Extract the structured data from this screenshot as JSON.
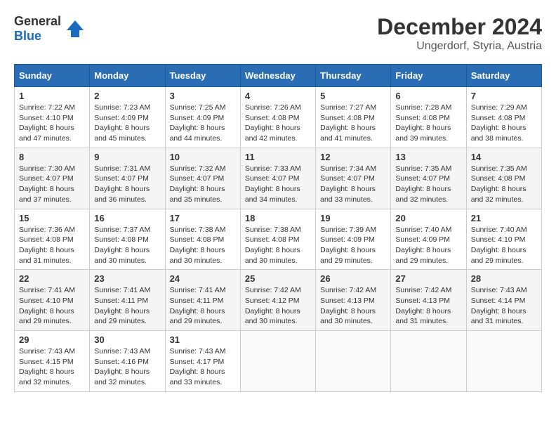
{
  "header": {
    "logo_line1": "General",
    "logo_line2": "Blue",
    "month_year": "December 2024",
    "location": "Ungerdorf, Styria, Austria"
  },
  "calendar": {
    "headers": [
      "Sunday",
      "Monday",
      "Tuesday",
      "Wednesday",
      "Thursday",
      "Friday",
      "Saturday"
    ],
    "weeks": [
      [
        null,
        null,
        null,
        null,
        null,
        null,
        null
      ]
    ],
    "days": {
      "1": {
        "sunrise": "7:22 AM",
        "sunset": "4:10 PM",
        "daylight": "8 hours and 47 minutes."
      },
      "2": {
        "sunrise": "7:23 AM",
        "sunset": "4:09 PM",
        "daylight": "8 hours and 45 minutes."
      },
      "3": {
        "sunrise": "7:25 AM",
        "sunset": "4:09 PM",
        "daylight": "8 hours and 44 minutes."
      },
      "4": {
        "sunrise": "7:26 AM",
        "sunset": "4:08 PM",
        "daylight": "8 hours and 42 minutes."
      },
      "5": {
        "sunrise": "7:27 AM",
        "sunset": "4:08 PM",
        "daylight": "8 hours and 41 minutes."
      },
      "6": {
        "sunrise": "7:28 AM",
        "sunset": "4:08 PM",
        "daylight": "8 hours and 39 minutes."
      },
      "7": {
        "sunrise": "7:29 AM",
        "sunset": "4:08 PM",
        "daylight": "8 hours and 38 minutes."
      },
      "8": {
        "sunrise": "7:30 AM",
        "sunset": "4:07 PM",
        "daylight": "8 hours and 37 minutes."
      },
      "9": {
        "sunrise": "7:31 AM",
        "sunset": "4:07 PM",
        "daylight": "8 hours and 36 minutes."
      },
      "10": {
        "sunrise": "7:32 AM",
        "sunset": "4:07 PM",
        "daylight": "8 hours and 35 minutes."
      },
      "11": {
        "sunrise": "7:33 AM",
        "sunset": "4:07 PM",
        "daylight": "8 hours and 34 minutes."
      },
      "12": {
        "sunrise": "7:34 AM",
        "sunset": "4:07 PM",
        "daylight": "8 hours and 33 minutes."
      },
      "13": {
        "sunrise": "7:35 AM",
        "sunset": "4:07 PM",
        "daylight": "8 hours and 32 minutes."
      },
      "14": {
        "sunrise": "7:35 AM",
        "sunset": "4:08 PM",
        "daylight": "8 hours and 32 minutes."
      },
      "15": {
        "sunrise": "7:36 AM",
        "sunset": "4:08 PM",
        "daylight": "8 hours and 31 minutes."
      },
      "16": {
        "sunrise": "7:37 AM",
        "sunset": "4:08 PM",
        "daylight": "8 hours and 30 minutes."
      },
      "17": {
        "sunrise": "7:38 AM",
        "sunset": "4:08 PM",
        "daylight": "8 hours and 30 minutes."
      },
      "18": {
        "sunrise": "7:38 AM",
        "sunset": "4:08 PM",
        "daylight": "8 hours and 30 minutes."
      },
      "19": {
        "sunrise": "7:39 AM",
        "sunset": "4:09 PM",
        "daylight": "8 hours and 29 minutes."
      },
      "20": {
        "sunrise": "7:40 AM",
        "sunset": "4:09 PM",
        "daylight": "8 hours and 29 minutes."
      },
      "21": {
        "sunrise": "7:40 AM",
        "sunset": "4:10 PM",
        "daylight": "8 hours and 29 minutes."
      },
      "22": {
        "sunrise": "7:41 AM",
        "sunset": "4:10 PM",
        "daylight": "8 hours and 29 minutes."
      },
      "23": {
        "sunrise": "7:41 AM",
        "sunset": "4:11 PM",
        "daylight": "8 hours and 29 minutes."
      },
      "24": {
        "sunrise": "7:41 AM",
        "sunset": "4:11 PM",
        "daylight": "8 hours and 29 minutes."
      },
      "25": {
        "sunrise": "7:42 AM",
        "sunset": "4:12 PM",
        "daylight": "8 hours and 30 minutes."
      },
      "26": {
        "sunrise": "7:42 AM",
        "sunset": "4:13 PM",
        "daylight": "8 hours and 30 minutes."
      },
      "27": {
        "sunrise": "7:42 AM",
        "sunset": "4:13 PM",
        "daylight": "8 hours and 31 minutes."
      },
      "28": {
        "sunrise": "7:43 AM",
        "sunset": "4:14 PM",
        "daylight": "8 hours and 31 minutes."
      },
      "29": {
        "sunrise": "7:43 AM",
        "sunset": "4:15 PM",
        "daylight": "8 hours and 32 minutes."
      },
      "30": {
        "sunrise": "7:43 AM",
        "sunset": "4:16 PM",
        "daylight": "8 hours and 32 minutes."
      },
      "31": {
        "sunrise": "7:43 AM",
        "sunset": "4:17 PM",
        "daylight": "8 hours and 33 minutes."
      }
    }
  }
}
